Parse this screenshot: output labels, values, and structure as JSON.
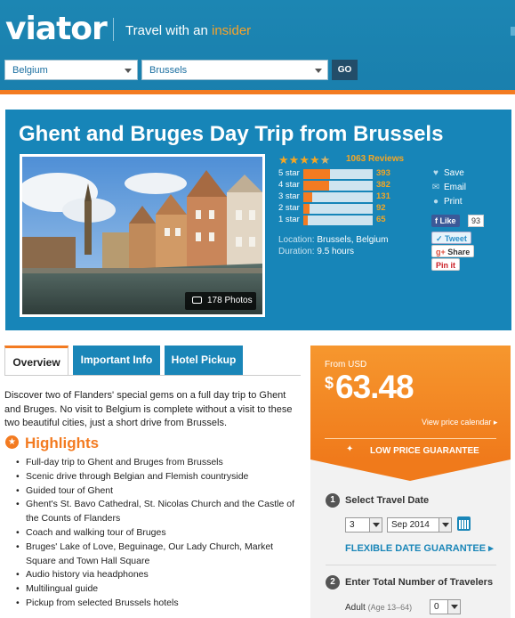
{
  "header": {
    "logo": "viator",
    "tagline_pre": "Travel with an ",
    "tagline_accent": "insider",
    "country_select": "Belgium",
    "city_select": "Brussels",
    "go_label": "GO"
  },
  "tour": {
    "title": "Ghent and Bruges Day Trip from Brussels",
    "photos_label": "178 Photos",
    "rating_value": 4.5,
    "reviews_label": "1063 Reviews",
    "ratings": [
      {
        "label": "5 star",
        "count": "393",
        "fraction": 0.38
      },
      {
        "label": "4 star",
        "count": "382",
        "fraction": 0.37
      },
      {
        "label": "3 star",
        "count": "131",
        "fraction": 0.13
      },
      {
        "label": "2 star",
        "count": "92",
        "fraction": 0.09
      },
      {
        "label": "1 star",
        "count": "65",
        "fraction": 0.07
      }
    ],
    "location_label": "Location:",
    "location_value": "Brussels, Belgium",
    "duration_label": "Duration:",
    "duration_value": "9.5 hours"
  },
  "actions": {
    "save": "Save",
    "email": "Email",
    "print": "Print",
    "fb_like": "Like",
    "fb_count": "93",
    "tweet": "Tweet",
    "share": "Share",
    "pin": "Pin it"
  },
  "tabs": {
    "overview": "Overview",
    "important_info": "Important Info",
    "hotel_pickup": "Hotel Pickup"
  },
  "overview": {
    "description": "Discover two of Flanders' special gems on a full day trip to Ghent and Bruges. No visit to Belgium is complete without a visit to these two beautiful cities, just a short drive from Brussels.",
    "highlights_title": "Highlights",
    "highlights": [
      "Full-day trip to Ghent and Bruges from Brussels",
      "Scenic drive through Belgian and Flemish countryside",
      "Guided tour of Ghent",
      "Ghent's St. Bavo Cathedral, St. Nicolas Church and the Castle of the Counts of Flanders",
      "Coach and walking tour of Bruges",
      "Bruges' Lake of Love, Beguinage, Our Lady Church, Market Square and Town Hall Square",
      "Audio history via headphones",
      "Multilingual guide",
      "Pickup from selected Brussels hotels"
    ]
  },
  "booking": {
    "from_label": "From USD",
    "currency_symbol": "$",
    "price": "63.48",
    "calendar_link": "View price calendar ▸",
    "guarantee": "LOW PRICE GUARANTEE",
    "step1_num": "1",
    "step1_title": "Select Travel Date",
    "day_value": "3",
    "month_value": "Sep 2014",
    "flexible_guarantee": "FLEXIBLE DATE GUARANTEE ▸",
    "step2_num": "2",
    "step2_title": "Enter Total Number of Travelers",
    "adult_label": "Adult",
    "adult_age": "(Age 13–64)",
    "adult_count": "0"
  },
  "colors": {
    "brand_blue": "#1a86b8",
    "accent_orange": "#f37b21",
    "star_gold": "#f5a623"
  }
}
